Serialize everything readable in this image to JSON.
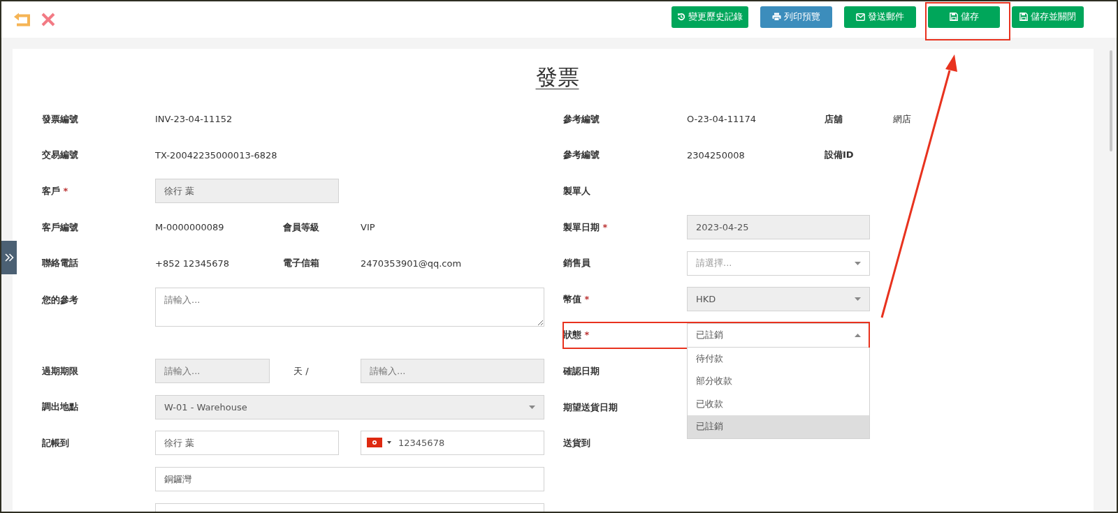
{
  "toolbar": {
    "buttons": [
      {
        "label": "變更歷史記錄",
        "kind": "history",
        "color": "#00a65a",
        "highlighted": false
      },
      {
        "label": "列印預覽",
        "kind": "print",
        "color": "#3c8dbc",
        "highlighted": false
      },
      {
        "label": "發送郵件",
        "kind": "mail",
        "color": "#00a65a",
        "highlighted": false
      },
      {
        "label": "儲存",
        "kind": "save",
        "color": "#00a65a",
        "highlighted": true
      },
      {
        "label": "儲存並關閉",
        "kind": "save",
        "color": "#00a65a",
        "highlighted": false
      }
    ]
  },
  "title": "發票",
  "left_rows": [
    {
      "kind": "text",
      "label": "發票編號",
      "value": "INV-23-04-11152"
    },
    {
      "kind": "text",
      "label": "交易編號",
      "value": "TX-20042235000013-6828"
    },
    {
      "kind": "input",
      "label": "客戶",
      "required_mark": "*",
      "value": "徐行 葉",
      "disabled": true
    },
    {
      "kind": "text",
      "label": "客戶編號",
      "value": "M-0000000089",
      "extra_label": "會員等級",
      "extra_value": "VIP"
    },
    {
      "kind": "text",
      "label": "聯絡電話",
      "value": "+852 12345678",
      "extra_label": "電子信箱",
      "extra_value": "2470353901@qq.com"
    },
    {
      "kind": "textarea",
      "label": "您的參考",
      "placeholder": "請輸入..."
    },
    {
      "kind": "range",
      "label": "過期期限",
      "placeholder": "請輸入...",
      "unit": "天 /",
      "placeholder_2": "請輸入...",
      "disabled": true
    },
    {
      "kind": "select",
      "label": "調出地點",
      "value": "W-01 - Warehouse",
      "disabled": true,
      "expanded": false
    },
    {
      "kind": "contact",
      "label": "記帳到",
      "value": "徐行 葉",
      "phone": "12345678"
    },
    {
      "kind": "wide_input",
      "value": "銅鑼灣"
    },
    {
      "kind": "wide_input"
    }
  ],
  "right_rows": [
    {
      "kind": "text",
      "label": "參考編號",
      "value": "O-23-04-11174",
      "extra_label": "店舖",
      "extra_value": "網店",
      "highlighted": false
    },
    {
      "kind": "text",
      "label": "參考編號",
      "value": "2304250008",
      "extra_label": "設備ID",
      "highlighted": false
    },
    {
      "kind": "text",
      "label": "製單人",
      "highlighted": false
    },
    {
      "kind": "input",
      "label": "製單日期",
      "required_mark": "*",
      "value": "2023-04-25",
      "disabled": true,
      "highlighted": false
    },
    {
      "kind": "select",
      "label": "銷售員",
      "placeholder": "請選擇...",
      "disabled": false,
      "expanded": false,
      "highlighted": false
    },
    {
      "kind": "select",
      "label": "幣值",
      "required_mark": "*",
      "value": "HKD",
      "disabled": true,
      "expanded": false,
      "highlighted": false
    },
    {
      "kind": "select",
      "label": "狀態",
      "required_mark": "*",
      "value": "已註銷",
      "disabled": false,
      "expanded": true,
      "highlighted": true,
      "options": [
        {
          "label": "待付款",
          "selected": false
        },
        {
          "label": "部分收款",
          "selected": false
        },
        {
          "label": "已收款",
          "selected": false
        },
        {
          "label": "已註銷",
          "selected": true
        }
      ]
    },
    {
      "kind": "text",
      "label": "確認日期",
      "highlighted": false
    },
    {
      "kind": "text",
      "label": "期望送貨日期",
      "highlighted": false
    },
    {
      "kind": "text",
      "label": "送貨到",
      "highlighted": false
    }
  ]
}
